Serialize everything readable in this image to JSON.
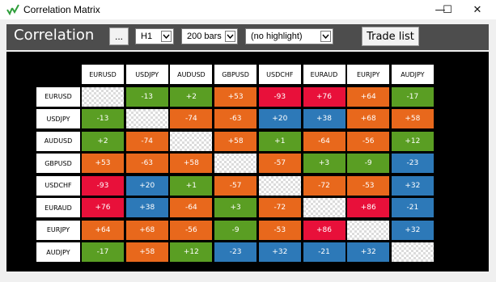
{
  "window": {
    "title": "Correlation Matrix",
    "minimize_glyph": "—",
    "maximize_glyph": "☐",
    "close_glyph": "✕",
    "icon": "chart-tick-icon"
  },
  "toolbar": {
    "heading": "Correlation",
    "settings_label": "...",
    "timeframe": "H1",
    "bars": "200 bars",
    "highlight": "(no highlight)",
    "trade_list_label": "Trade list"
  },
  "colors": {
    "positive_strong": "#e8681c",
    "positive_weak": "#5a9e23",
    "negative_strong": "#e8103a",
    "negative_weak": "#2d79b8",
    "toolbar_bg": "#4d4d4d",
    "matrix_bg": "#000000"
  },
  "matrix": {
    "symbols": [
      "EURUSD",
      "USDJPY",
      "AUDUSD",
      "GBPUSD",
      "USDCHF",
      "EURAUD",
      "EURJPY",
      "AUDJPY"
    ],
    "values": [
      [
        null,
        "-13",
        "+2",
        "+53",
        "-93",
        "+76",
        "+64",
        "-17"
      ],
      [
        "-13",
        null,
        "-74",
        "-63",
        "+20",
        "+38",
        "+68",
        "+58"
      ],
      [
        "+2",
        "-74",
        null,
        "+58",
        "+1",
        "-64",
        "-56",
        "+12"
      ],
      [
        "+53",
        "-63",
        "+58",
        null,
        "-57",
        "+3",
        "-9",
        "-23"
      ],
      [
        "-93",
        "+20",
        "+1",
        "-57",
        null,
        "-72",
        "-53",
        "+32"
      ],
      [
        "+76",
        "+38",
        "-64",
        "+3",
        "-72",
        null,
        "+86",
        "-21"
      ],
      [
        "+64",
        "+68",
        "-56",
        "-9",
        "-53",
        "+86",
        null,
        "+32"
      ],
      [
        "-17",
        "+58",
        "+12",
        "-23",
        "+32",
        "-21",
        "+32",
        null
      ]
    ],
    "cell_colors": [
      [
        null,
        "#5a9e23",
        "#5a9e23",
        "#e8681c",
        "#e8103a",
        "#e8103a",
        "#e8681c",
        "#5a9e23"
      ],
      [
        "#5a9e23",
        null,
        "#e8681c",
        "#e8681c",
        "#2d79b8",
        "#2d79b8",
        "#e8681c",
        "#e8681c"
      ],
      [
        "#5a9e23",
        "#e8681c",
        null,
        "#e8681c",
        "#5a9e23",
        "#e8681c",
        "#e8681c",
        "#5a9e23"
      ],
      [
        "#e8681c",
        "#e8681c",
        "#e8681c",
        null,
        "#e8681c",
        "#5a9e23",
        "#5a9e23",
        "#2d79b8"
      ],
      [
        "#e8103a",
        "#2d79b8",
        "#5a9e23",
        "#e8681c",
        null,
        "#e8681c",
        "#e8681c",
        "#2d79b8"
      ],
      [
        "#e8103a",
        "#2d79b8",
        "#e8681c",
        "#5a9e23",
        "#e8681c",
        null,
        "#e8103a",
        "#2d79b8"
      ],
      [
        "#e8681c",
        "#e8681c",
        "#e8681c",
        "#5a9e23",
        "#e8681c",
        "#e8103a",
        null,
        "#2d79b8"
      ],
      [
        "#5a9e23",
        "#e8681c",
        "#5a9e23",
        "#2d79b8",
        "#2d79b8",
        "#2d79b8",
        "#2d79b8",
        null
      ]
    ]
  }
}
